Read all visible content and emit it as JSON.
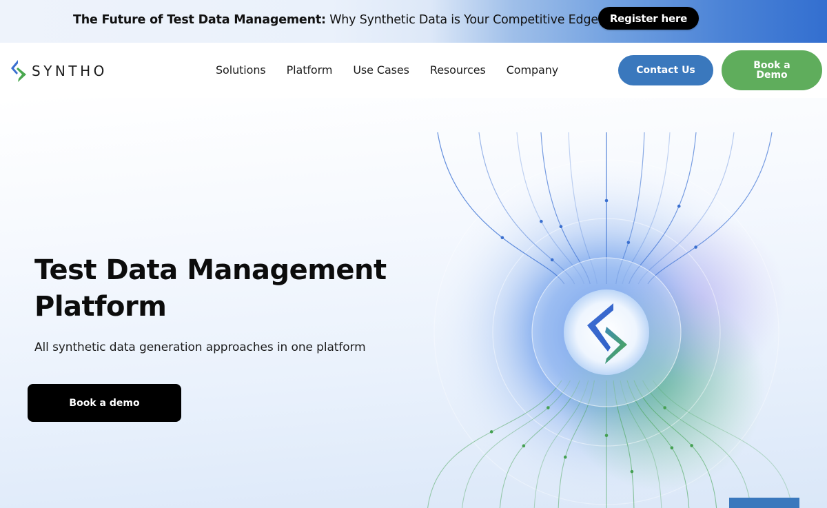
{
  "banner": {
    "bold_text": "The Future of Test Data Management:",
    "rest_text": " Why Synthetic Data is Your Competitive Edge",
    "register_label": "Register here"
  },
  "header": {
    "logo_text": "SYNTHO",
    "logo_icon": "syntho-chevrons-icon",
    "nav": [
      {
        "label": "Solutions"
      },
      {
        "label": "Platform"
      },
      {
        "label": "Use Cases"
      },
      {
        "label": "Resources"
      },
      {
        "label": "Company"
      }
    ],
    "contact_label": "Contact Us",
    "demo_label": "Book a Demo"
  },
  "hero": {
    "title": "Test Data Management Platform",
    "subtitle": "All synthetic data generation approaches in one platform",
    "cta_label": "Book a demo",
    "visual_icon": "syntho-orb-icon"
  },
  "colors": {
    "brand_blue": "#3a78bd",
    "brand_green": "#5fad5c",
    "logo_blue": "#3b6fd0",
    "logo_green": "#4aa84f",
    "black": "#000000"
  }
}
